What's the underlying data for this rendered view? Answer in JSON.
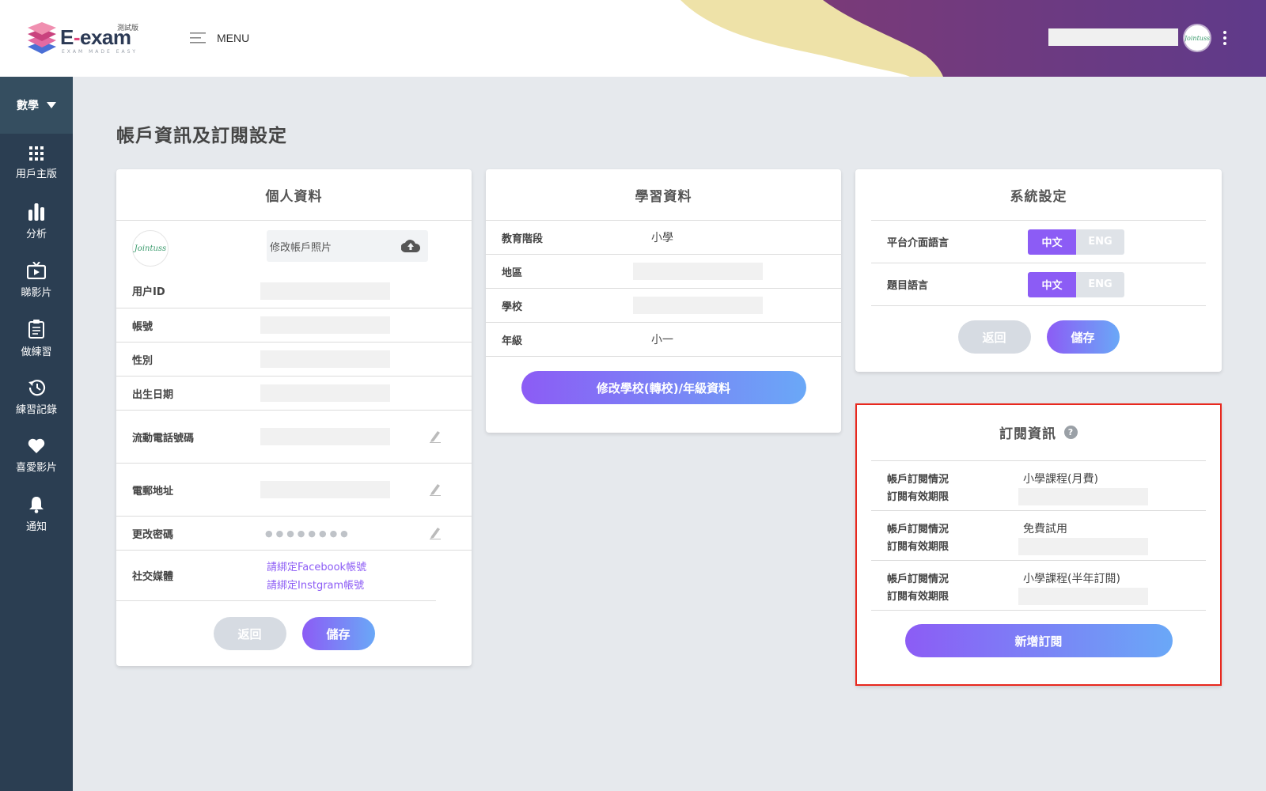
{
  "header": {
    "logo": {
      "brand": "E-exam",
      "tag": "測試版",
      "tagline": "EXAM MADE EASY"
    },
    "menu_label": "MENU",
    "avatar_text": "Jointuss"
  },
  "sidebar": {
    "subject": "數學",
    "items": [
      {
        "label": "用戶主版",
        "icon": "grid-icon"
      },
      {
        "label": "分析",
        "icon": "bar-chart-icon"
      },
      {
        "label": "睇影片",
        "icon": "tv-icon"
      },
      {
        "label": "做練習",
        "icon": "clipboard-icon"
      },
      {
        "label": "練習記錄",
        "icon": "history-icon"
      },
      {
        "label": "喜愛影片",
        "icon": "heart-icon"
      },
      {
        "label": "通知",
        "icon": "bell-icon"
      }
    ]
  },
  "page_title": "帳戶資訊及訂閱設定",
  "personal": {
    "title": "個人資料",
    "avatar_text": "Jointuss",
    "upload_label": "修改帳戶照片",
    "fields": {
      "user_id": "用户ID",
      "account": "帳號",
      "gender": "性別",
      "dob": "出生日期",
      "mobile": "流動電話號碼",
      "email": "電郵地址",
      "password": "更改密碼",
      "social": "社交媒體"
    },
    "password_mask": "●●●●●●●●",
    "facebook_link": "請綁定Facebook帳號",
    "instagram_link": "請綁定Instgram帳號",
    "back": "返回",
    "save": "儲存"
  },
  "learning": {
    "title": "學習資料",
    "education_level_label": "教育階段",
    "education_level_value": "小學",
    "region_label": "地區",
    "school_label": "學校",
    "grade_label": "年級",
    "grade_value": "小一",
    "edit_button": "修改學校(轉校)/年級資料"
  },
  "system": {
    "title": "系統設定",
    "ui_language_label": "平台介面語言",
    "question_language_label": "題目語言",
    "lang_zh": "中文",
    "lang_en": "ENG",
    "selected": "中文",
    "back": "返回",
    "save": "儲存"
  },
  "subscription": {
    "title": "訂閱資訊",
    "status_label": "帳戶訂閱情況",
    "expiry_label": "訂閱有效期限",
    "items": [
      {
        "plan": "小學課程(月費)"
      },
      {
        "plan": "免費試用"
      },
      {
        "plan": "小學課程(半年訂閱)"
      }
    ],
    "add_button": "新增訂閱"
  },
  "colors": {
    "sidebar": "#2b3e52",
    "accent_purple": "#8c5cf5",
    "accent_blue": "#6aa8f7",
    "highlight_red": "#e8281e"
  }
}
